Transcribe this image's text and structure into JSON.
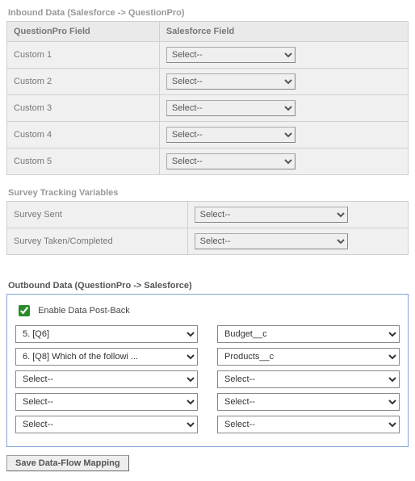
{
  "inbound": {
    "title": "Inbound Data (Salesforce -> QuestionPro)",
    "headers": {
      "qp": "QuestionPro Field",
      "sf": "Salesforce Field"
    },
    "rows": [
      {
        "label": "Custom 1",
        "value": "Select--"
      },
      {
        "label": "Custom 2",
        "value": "Select--"
      },
      {
        "label": "Custom 3",
        "value": "Select--"
      },
      {
        "label": "Custom 4",
        "value": "Select--"
      },
      {
        "label": "Custom 5",
        "value": "Select--"
      }
    ]
  },
  "tracking": {
    "title": "Survey Tracking Variables",
    "rows": [
      {
        "label": "Survey Sent",
        "value": "Select--"
      },
      {
        "label": "Survey Taken/Completed",
        "value": "Select--"
      }
    ]
  },
  "outbound": {
    "title": "Outbound Data (QuestionPro -> Salesforce)",
    "checkbox_label": "Enable Data Post-Back",
    "checkbox_checked": true,
    "rows": [
      {
        "left": "5. [Q6]",
        "right": "Budget__c"
      },
      {
        "left": "6. [Q8] Which of the followi ...",
        "right": "Products__c"
      },
      {
        "left": "Select--",
        "right": "Select--"
      },
      {
        "left": "Select--",
        "right": "Select--"
      },
      {
        "left": "Select--",
        "right": "Select--"
      }
    ]
  },
  "save_label": "Save Data-Flow Mapping"
}
